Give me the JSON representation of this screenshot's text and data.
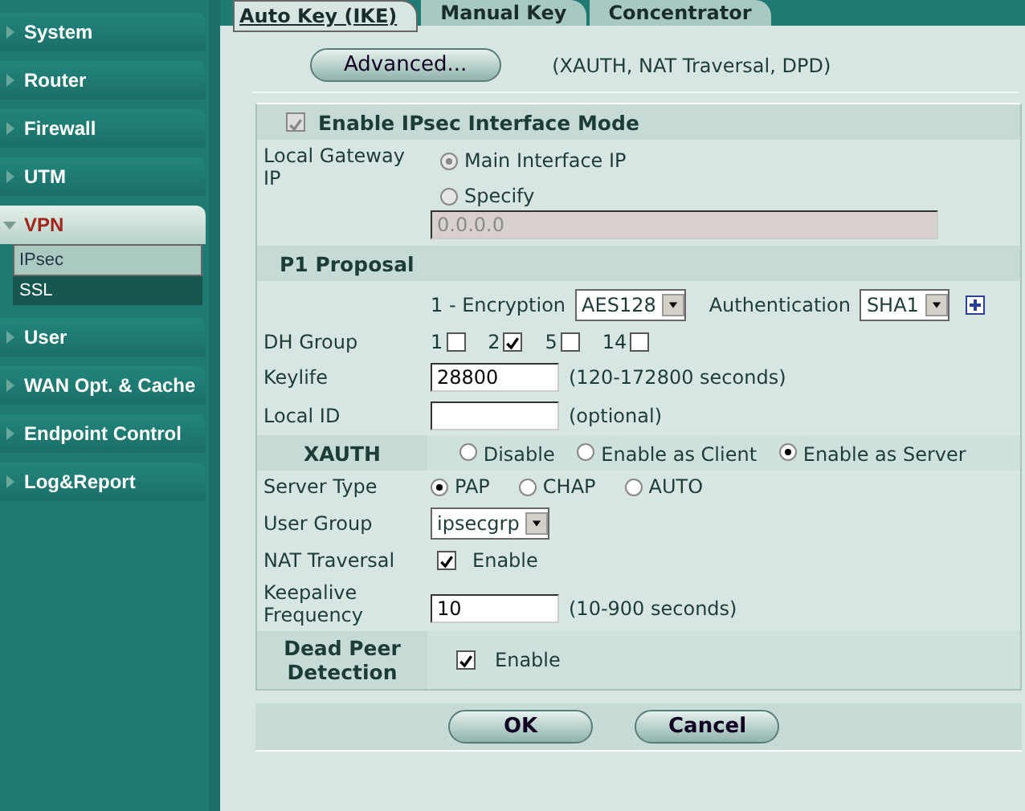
{
  "sidebar": {
    "items": [
      {
        "label": "System",
        "expanded": false
      },
      {
        "label": "Router",
        "expanded": false
      },
      {
        "label": "Firewall",
        "expanded": false
      },
      {
        "label": "UTM",
        "expanded": false
      },
      {
        "label": "VPN",
        "expanded": true,
        "children": [
          {
            "label": "IPsec",
            "selected": true
          },
          {
            "label": "SSL",
            "selected": false
          }
        ]
      },
      {
        "label": "User",
        "expanded": false
      },
      {
        "label": "WAN Opt. & Cache",
        "expanded": false
      },
      {
        "label": "Endpoint Control",
        "expanded": false
      },
      {
        "label": "Log&Report",
        "expanded": false
      }
    ]
  },
  "tabs": [
    {
      "label": "Auto Key (IKE)",
      "selected": true
    },
    {
      "label": "Manual Key",
      "selected": false
    },
    {
      "label": "Concentrator",
      "selected": false
    }
  ],
  "advanced": {
    "button": "Advanced...",
    "note": "(XAUTH, NAT Traversal, DPD)"
  },
  "form": {
    "interface_mode": {
      "label": "Enable IPsec Interface Mode",
      "checked": true,
      "disabled": true
    },
    "local_gateway": {
      "label": "Local Gateway IP",
      "disabled": true,
      "options": [
        {
          "label": "Main Interface IP",
          "selected": true
        },
        {
          "label": "Specify",
          "selected": false
        }
      ],
      "specify_value": "0.0.0.0"
    },
    "p1_proposal": {
      "title": "P1 Proposal",
      "encryption_label": "1 - Encryption",
      "encryption": "AES128",
      "authentication_label": "Authentication",
      "authentication": "SHA1"
    },
    "dh_group": {
      "label": "DH Group",
      "options": [
        {
          "label": "1",
          "checked": false
        },
        {
          "label": "2",
          "checked": true
        },
        {
          "label": "5",
          "checked": false
        },
        {
          "label": "14",
          "checked": false
        }
      ]
    },
    "keylife": {
      "label": "Keylife",
      "value": "28800",
      "hint": "(120-172800 seconds)"
    },
    "local_id": {
      "label": "Local ID",
      "hint": "(optional)"
    },
    "xauth": {
      "label": "XAUTH",
      "options": [
        {
          "label": "Disable",
          "selected": false
        },
        {
          "label": "Enable as Client",
          "selected": false
        },
        {
          "label": "Enable as Server",
          "selected": true
        }
      ]
    },
    "server_type": {
      "label": "Server Type",
      "options": [
        {
          "label": "PAP",
          "selected": true
        },
        {
          "label": "CHAP",
          "selected": false
        },
        {
          "label": "AUTO",
          "selected": false
        }
      ]
    },
    "user_group": {
      "label": "User Group",
      "value": "ipsecgrp"
    },
    "nat_traversal": {
      "label": "NAT Traversal",
      "checked": true,
      "option": "Enable"
    },
    "keepalive": {
      "label": "Keepalive Frequency",
      "value": "10",
      "hint": "(10-900 seconds)"
    },
    "dpd": {
      "label": "Dead Peer Detection",
      "checked": true,
      "option": "Enable"
    }
  },
  "buttons": [
    "OK",
    "Cancel"
  ]
}
